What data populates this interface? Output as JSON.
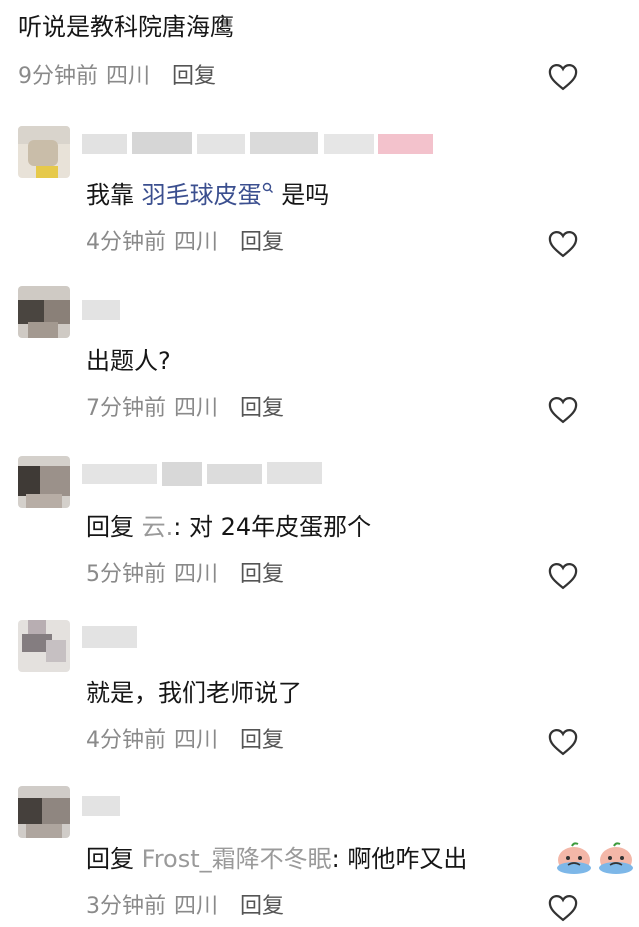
{
  "comments": [
    {
      "text": "听说是教科院唐海鹰",
      "time": "9分钟前",
      "location": "四川",
      "reply": "回复"
    },
    {
      "text_prefix": "我靠 ",
      "topic": "羽毛球皮蛋",
      "topic_icon": "search-small-icon",
      "text_suffix": " 是吗",
      "time": "4分钟前",
      "location": "四川",
      "reply": "回复"
    },
    {
      "text": "出题人?",
      "time": "7分钟前",
      "location": "四川",
      "reply": "回复"
    },
    {
      "reply_prefix": "回复 ",
      "reply_to": "云.",
      "text": ": 对 24年皮蛋那个",
      "time": "5分钟前",
      "location": "四川",
      "reply": "回复"
    },
    {
      "text": "就是，我们老师说了",
      "time": "4分钟前",
      "location": "四川",
      "reply": "回复"
    },
    {
      "reply_prefix": "回复 ",
      "reply_to": "Frost_霜降不冬眠",
      "text": ": 啊他咋又出",
      "emoji": "crying-emoji",
      "time": "3分钟前",
      "location": "四川",
      "reply": "回复"
    }
  ]
}
